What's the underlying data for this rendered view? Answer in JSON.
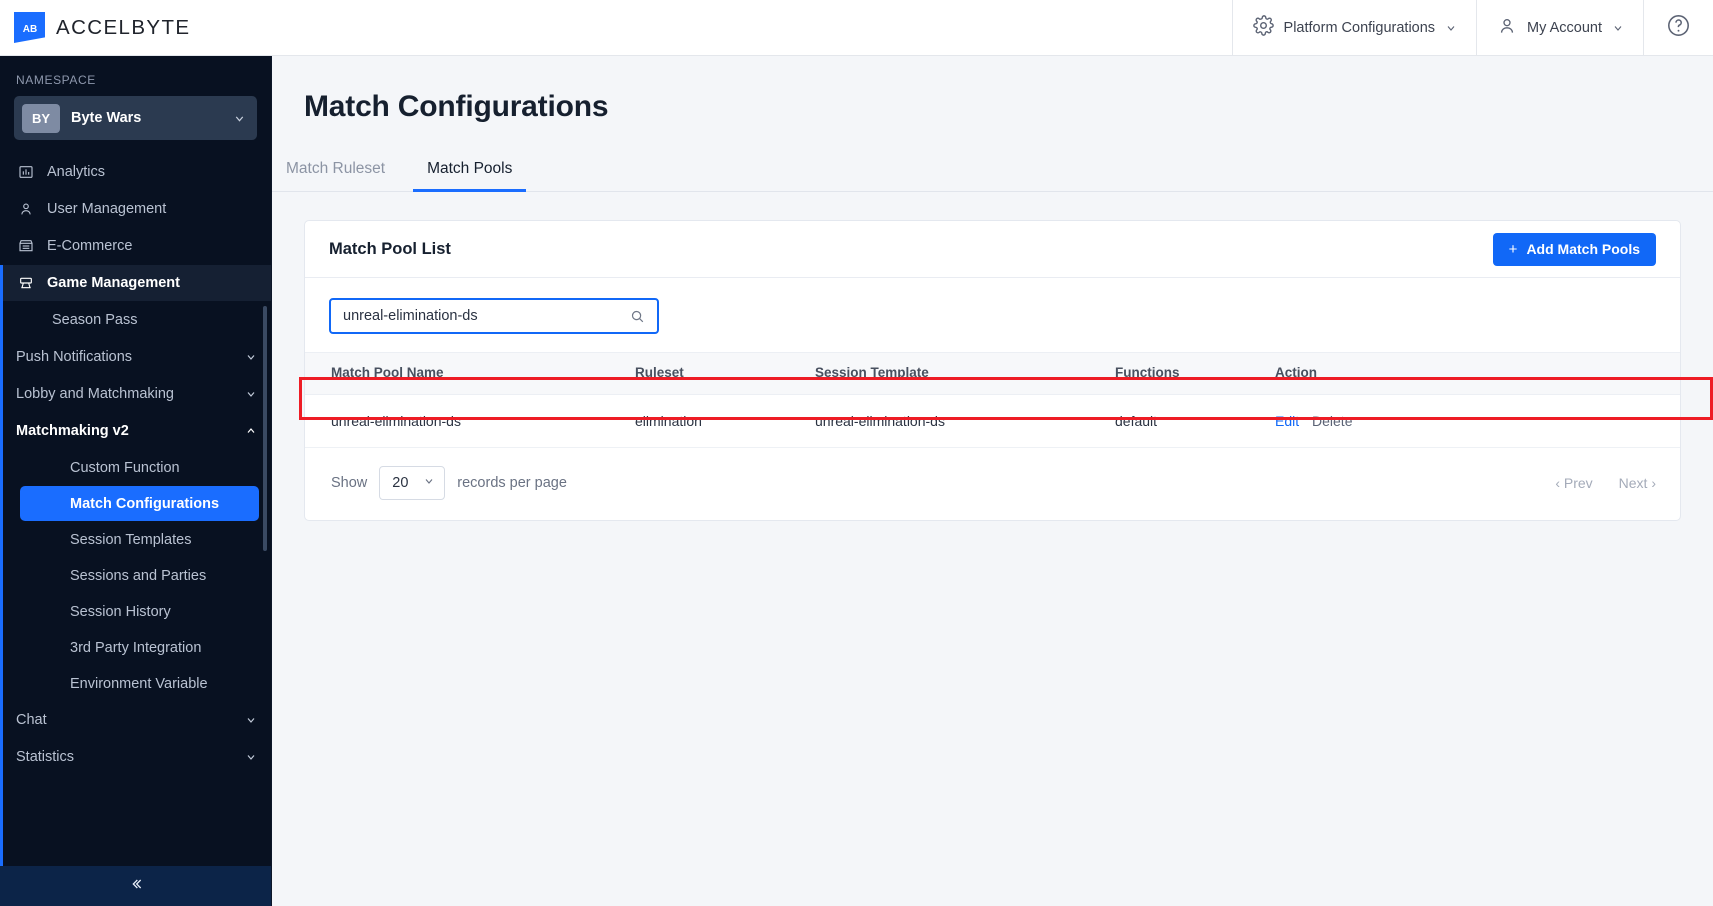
{
  "topbar": {
    "brand_name": "ACCELBYTE",
    "brand_icon": "accelbyte-logo-icon",
    "platform_config_label": "Platform Configurations",
    "platform_config_icon": "gear-icon",
    "account_label": "My Account",
    "account_icon": "person-icon",
    "help_icon": "question-circle-icon",
    "chevron_icon": "chevron-down-icon"
  },
  "sidebar": {
    "namespace_label": "NAMESPACE",
    "namespace_badge": "BY",
    "namespace_name": "Byte Wars",
    "namespace_chevron_icon": "chevron-down-icon",
    "collapse_icon": "double-chevron-left-icon",
    "items": [
      {
        "label": "Analytics",
        "icon": "chart-bar-icon"
      },
      {
        "label": "User Management",
        "icon": "person-icon"
      },
      {
        "label": "E-Commerce",
        "icon": "store-icon"
      },
      {
        "label": "Game Management",
        "icon": "game-controller-icon"
      }
    ],
    "sub_items": [
      {
        "label": "Season Pass",
        "expandable": false
      },
      {
        "label": "Push Notifications",
        "expandable": true,
        "icon": "chevron-down-icon"
      },
      {
        "label": "Lobby and Matchmaking",
        "expandable": true,
        "icon": "chevron-down-icon"
      },
      {
        "label": "Matchmaking v2",
        "expandable": true,
        "icon": "chevron-up-icon"
      }
    ],
    "leaf_items": [
      {
        "label": "Custom Function"
      },
      {
        "label": "Match Configurations"
      },
      {
        "label": "Session Templates"
      },
      {
        "label": "Sessions and Parties"
      },
      {
        "label": "Session History"
      },
      {
        "label": "3rd Party Integration"
      },
      {
        "label": "Environment Variable"
      }
    ],
    "tail_items": [
      {
        "label": "Chat",
        "icon": "chevron-down-icon"
      },
      {
        "label": "Statistics",
        "icon": "chevron-down-icon"
      }
    ]
  },
  "page": {
    "title": "Match Configurations",
    "tabs": [
      {
        "label": "Match Ruleset",
        "active": false
      },
      {
        "label": "Match Pools",
        "active": true
      }
    ]
  },
  "card": {
    "title": "Match Pool List",
    "add_button_label": "Add Match Pools",
    "add_button_icon": "plus-icon",
    "search": {
      "value": "unreal-elimination-ds",
      "placeholder": "Search",
      "icon": "search-icon"
    },
    "table": {
      "columns": [
        "Match Pool Name",
        "Ruleset",
        "Session Template",
        "Functions",
        "Action"
      ],
      "rows": [
        {
          "match_pool_name": "unreal-elimination-ds",
          "ruleset": "elimination",
          "session_template": "unreal-elimination-ds",
          "functions": "default",
          "action_edit": "Edit",
          "action_delete": "Delete"
        }
      ]
    },
    "footer": {
      "show_label": "Show",
      "page_size": "20",
      "page_size_chevron_icon": "chevron-down-icon",
      "records_label": "records per page",
      "prev_label": "‹ Prev",
      "next_label": "Next ›"
    }
  },
  "colors": {
    "accent_blue": "#1168f7",
    "sidebar_bg": "#081121",
    "annotation_red": "#ee1c25"
  }
}
